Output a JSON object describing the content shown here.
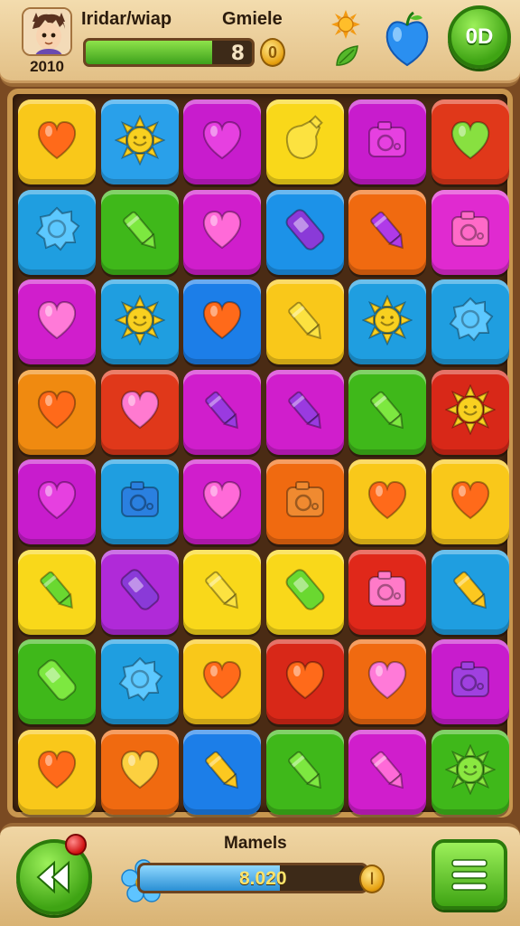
{
  "header": {
    "player_name": "Iridar/wiap",
    "level": "2010",
    "mode_label": "Gmiele",
    "progress_value": "8",
    "progress_fraction": 0.76,
    "coin_glyph": "0",
    "right_button_label": "0D",
    "icons": [
      "avatar",
      "sun-icon",
      "leaf-icon",
      "apple-icon"
    ]
  },
  "board": {
    "rows": 8,
    "cols": 6,
    "tiles": [
      [
        {
          "color": "#f9c81a",
          "icon": "heart",
          "iconColor": "#ff6a1a"
        },
        {
          "color": "#29a0ea",
          "icon": "sun",
          "iconColor": "#f8d020"
        },
        {
          "color": "#c81ccd",
          "icon": "heart",
          "iconColor": "#e640e0"
        },
        {
          "color": "#f9d81a",
          "icon": "bottle",
          "iconColor": "#fce240"
        },
        {
          "color": "#c81ccd",
          "icon": "camera",
          "iconColor": "#e640e0"
        },
        {
          "color": "#e0381a",
          "icon": "heart",
          "iconColor": "#88e040"
        }
      ],
      [
        {
          "color": "#1f9ee0",
          "icon": "badge",
          "iconColor": "#5cc8ff"
        },
        {
          "color": "#3fb81a",
          "icon": "crayon",
          "iconColor": "#7de840"
        },
        {
          "color": "#d01ecc",
          "icon": "heart",
          "iconColor": "#ff6ad8"
        },
        {
          "color": "#1c92e8",
          "icon": "usb",
          "iconColor": "#8a3ad8"
        },
        {
          "color": "#f06a10",
          "icon": "crayon",
          "iconColor": "#b03ae8"
        },
        {
          "color": "#e02ad0",
          "icon": "camera",
          "iconColor": "#ff6ac8"
        }
      ],
      [
        {
          "color": "#d01ecc",
          "icon": "heart",
          "iconColor": "#ff7ad8"
        },
        {
          "color": "#1f9ee0",
          "icon": "sun",
          "iconColor": "#f8d020"
        },
        {
          "color": "#1c7ee8",
          "icon": "heart",
          "iconColor": "#ff6a1a"
        },
        {
          "color": "#f9c81a",
          "icon": "crayon",
          "iconColor": "#fce240"
        },
        {
          "color": "#1f9ee0",
          "icon": "sun",
          "iconColor": "#f8d020"
        },
        {
          "color": "#1f9ee0",
          "icon": "badge",
          "iconColor": "#5cc8ff"
        }
      ],
      [
        {
          "color": "#f08a10",
          "icon": "heart",
          "iconColor": "#ff6a1a"
        },
        {
          "color": "#e0381a",
          "icon": "heart",
          "iconColor": "#ff7ad0"
        },
        {
          "color": "#d01ecc",
          "icon": "crayon",
          "iconColor": "#9a3ae0"
        },
        {
          "color": "#d01ecc",
          "icon": "crayon",
          "iconColor": "#9a3ae0"
        },
        {
          "color": "#3fb81a",
          "icon": "crayon",
          "iconColor": "#7de840"
        },
        {
          "color": "#d82818",
          "icon": "sun",
          "iconColor": "#f8d020"
        }
      ],
      [
        {
          "color": "#c81ccd",
          "icon": "heart",
          "iconColor": "#e640e0"
        },
        {
          "color": "#1f9ee0",
          "icon": "camera",
          "iconColor": "#2a80e0"
        },
        {
          "color": "#d01ecc",
          "icon": "heart",
          "iconColor": "#ff6ad8"
        },
        {
          "color": "#f06a10",
          "icon": "camera",
          "iconColor": "#f08a30"
        },
        {
          "color": "#f9c81a",
          "icon": "heart",
          "iconColor": "#ff6a1a"
        },
        {
          "color": "#f9c81a",
          "icon": "heart",
          "iconColor": "#ff6a1a"
        }
      ],
      [
        {
          "color": "#f9d81a",
          "icon": "crayon",
          "iconColor": "#6ad830"
        },
        {
          "color": "#b02ad8",
          "icon": "usb",
          "iconColor": "#8a3ad8"
        },
        {
          "color": "#f9d81a",
          "icon": "crayon",
          "iconColor": "#fce240"
        },
        {
          "color": "#f9d81a",
          "icon": "usb",
          "iconColor": "#6ad830"
        },
        {
          "color": "#e0281a",
          "icon": "camera",
          "iconColor": "#ff7ac8"
        },
        {
          "color": "#1f9ee0",
          "icon": "crayon",
          "iconColor": "#fcc820"
        }
      ],
      [
        {
          "color": "#3fb81a",
          "icon": "usb",
          "iconColor": "#7de840"
        },
        {
          "color": "#1f9ee0",
          "icon": "badge",
          "iconColor": "#5cc8ff"
        },
        {
          "color": "#f9c81a",
          "icon": "heart",
          "iconColor": "#ff6a1a"
        },
        {
          "color": "#d82818",
          "icon": "heart",
          "iconColor": "#ff6a1a"
        },
        {
          "color": "#f06a10",
          "icon": "heart",
          "iconColor": "#ff7ad8"
        },
        {
          "color": "#c81ccd",
          "icon": "camera",
          "iconColor": "#a040e0"
        }
      ],
      [
        {
          "color": "#f9c81a",
          "icon": "heart",
          "iconColor": "#ff6a1a"
        },
        {
          "color": "#f06a10",
          "icon": "heart",
          "iconColor": "#fcd040"
        },
        {
          "color": "#1c7ee8",
          "icon": "crayon",
          "iconColor": "#fcc820"
        },
        {
          "color": "#3fb81a",
          "icon": "crayon",
          "iconColor": "#7de840"
        },
        {
          "color": "#d01ecc",
          "icon": "crayon",
          "iconColor": "#ff6ad8"
        },
        {
          "color": "#3fb81a",
          "icon": "sun",
          "iconColor": "#8ae840"
        }
      ]
    ]
  },
  "footer": {
    "label": "Mamels",
    "score": "8.020",
    "progress_fraction": 0.62,
    "icons": [
      "back-arrow-icon",
      "flower-icon",
      "menu-icon"
    ]
  }
}
